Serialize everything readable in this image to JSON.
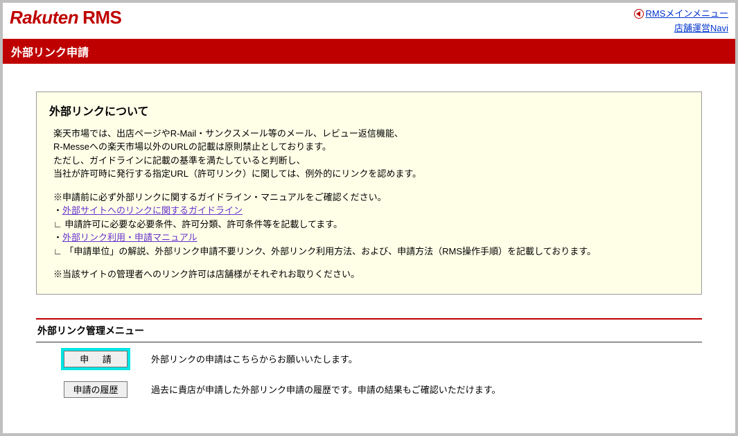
{
  "header": {
    "logo_main": "Rakuten",
    "logo_suffix": "RMS",
    "links": {
      "main_menu": "RMSメインメニュー",
      "navi": "店舗運営Navi"
    }
  },
  "page_title": "外部リンク申請",
  "info": {
    "title": "外部リンクについて",
    "p1": "楽天市場では、出店ページやR-Mail・サンクスメール等のメール、レビュー返信機能、",
    "p2": "R-Messeへの楽天市場以外のURLの記載は原則禁止としております。",
    "p3": "ただし、ガイドラインに記載の基準を満たしていると判断し、",
    "p4": "当社が許可時に発行する指定URL（許可リンク）に関しては、例外的にリンクを認めます。",
    "p5": "※申請前に必ず外部リンクに関するガイドライン・マニュアルをご確認ください。",
    "link1_prefix": "・",
    "link1": "外部サイトへのリンクに関するガイドライン",
    "p6": "∟ 申請許可に必要な必要条件、許可分類、許可条件等を記載してます。",
    "link2_prefix": "・",
    "link2": "外部リンク利用・申請マニュアル",
    "p7": "∟ 「申請単位」の解説、外部リンク申請不要リンク、外部リンク利用方法、および、申請方法（RMS操作手順）を記載しております。",
    "p8": "※当該サイトの管理者へのリンク許可は店舗様がそれぞれお取りください。"
  },
  "menu": {
    "title": "外部リンク管理メニュー",
    "items": [
      {
        "label": "申 請",
        "desc": "外部リンクの申請はこちらからお願いいたします。",
        "highlighted": true
      },
      {
        "label": "申請の履歴",
        "desc": "過去に貴店が申請した外部リンク申請の履歴です。申請の結果もご確認いただけます。",
        "highlighted": false
      }
    ]
  }
}
